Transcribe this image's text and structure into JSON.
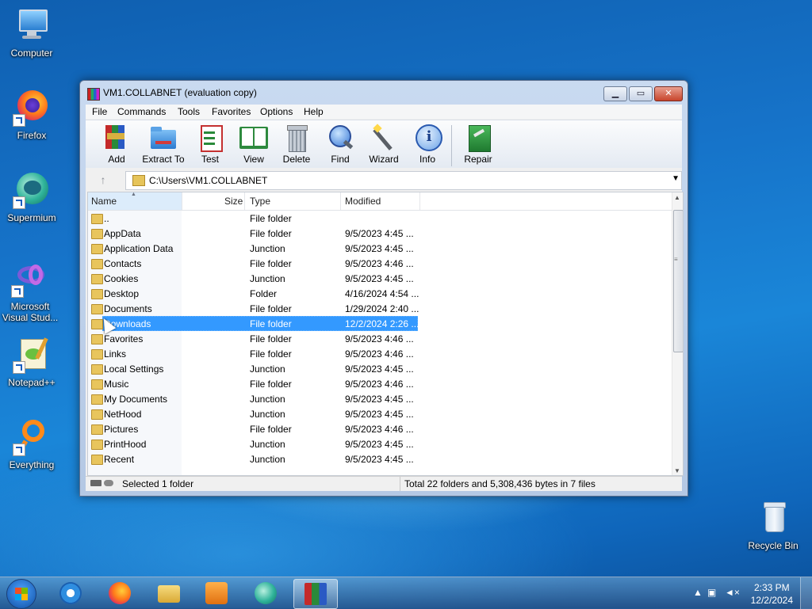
{
  "desktop": {
    "icons": [
      {
        "label": "Computer"
      },
      {
        "label": "Firefox"
      },
      {
        "label": "Supermium"
      },
      {
        "label": "Microsoft Visual Stud..."
      },
      {
        "label": "Notepad++"
      },
      {
        "label": "Everything"
      },
      {
        "label": "Recycle Bin"
      }
    ]
  },
  "window": {
    "title": "VM1.COLLABNET (evaluation copy)",
    "menu": [
      "File",
      "Commands",
      "Tools",
      "Favorites",
      "Options",
      "Help"
    ],
    "toolbar": [
      {
        "label": "Add",
        "icon": "add-archive-icon"
      },
      {
        "label": "Extract To",
        "icon": "extract-folder-icon"
      },
      {
        "label": "Test",
        "icon": "test-clipboard-icon"
      },
      {
        "label": "View",
        "icon": "view-book-icon"
      },
      {
        "label": "Delete",
        "icon": "trash-icon"
      },
      {
        "label": "Find",
        "icon": "magnifier-icon"
      },
      {
        "label": "Wizard",
        "icon": "wand-icon"
      },
      {
        "label": "Info",
        "icon": "info-icon"
      },
      {
        "label": "Repair",
        "icon": "repair-kit-icon"
      }
    ],
    "address": "C:\\Users\\VM1.COLLABNET",
    "columns": [
      "Name",
      "Size",
      "Type",
      "Modified"
    ],
    "rows": [
      {
        "name": "..",
        "size": "",
        "type": "File folder",
        "modified": ""
      },
      {
        "name": "AppData",
        "size": "",
        "type": "File folder",
        "modified": "9/5/2023 4:45 ..."
      },
      {
        "name": "Application Data",
        "size": "",
        "type": "Junction",
        "modified": "9/5/2023 4:45 ..."
      },
      {
        "name": "Contacts",
        "size": "",
        "type": "File folder",
        "modified": "9/5/2023 4:46 ..."
      },
      {
        "name": "Cookies",
        "size": "",
        "type": "Junction",
        "modified": "9/5/2023 4:45 ..."
      },
      {
        "name": "Desktop",
        "size": "",
        "type": "Folder",
        "modified": "4/16/2024 4:54 ..."
      },
      {
        "name": "Documents",
        "size": "",
        "type": "File folder",
        "modified": "1/29/2024 2:40 ..."
      },
      {
        "name": "Downloads",
        "size": "",
        "type": "File folder",
        "modified": "12/2/2024 2:26 ...",
        "selected": true
      },
      {
        "name": "Favorites",
        "size": "",
        "type": "File folder",
        "modified": "9/5/2023 4:46 ..."
      },
      {
        "name": "Links",
        "size": "",
        "type": "File folder",
        "modified": "9/5/2023 4:46 ..."
      },
      {
        "name": "Local Settings",
        "size": "",
        "type": "Junction",
        "modified": "9/5/2023 4:45 ..."
      },
      {
        "name": "Music",
        "size": "",
        "type": "File folder",
        "modified": "9/5/2023 4:46 ..."
      },
      {
        "name": "My Documents",
        "size": "",
        "type": "Junction",
        "modified": "9/5/2023 4:45 ..."
      },
      {
        "name": "NetHood",
        "size": "",
        "type": "Junction",
        "modified": "9/5/2023 4:45 ..."
      },
      {
        "name": "Pictures",
        "size": "",
        "type": "File folder",
        "modified": "9/5/2023 4:46 ..."
      },
      {
        "name": "PrintHood",
        "size": "",
        "type": "Junction",
        "modified": "9/5/2023 4:45 ..."
      },
      {
        "name": "Recent",
        "size": "",
        "type": "Junction",
        "modified": "9/5/2023 4:45 ..."
      }
    ],
    "status_left": "Selected 1 folder",
    "status_right": "Total 22 folders and 5,308,436 bytes in 7 files"
  },
  "taskbar": {
    "items": [
      "Internet Explorer",
      "Firefox",
      "File Explorer",
      "Media Player",
      "Supermium",
      "WinRAR"
    ],
    "clock_time": "2:33 PM",
    "clock_date": "12/2/2024"
  },
  "colors": {
    "selection": "#3399ff",
    "desktop": "#1673c9"
  }
}
